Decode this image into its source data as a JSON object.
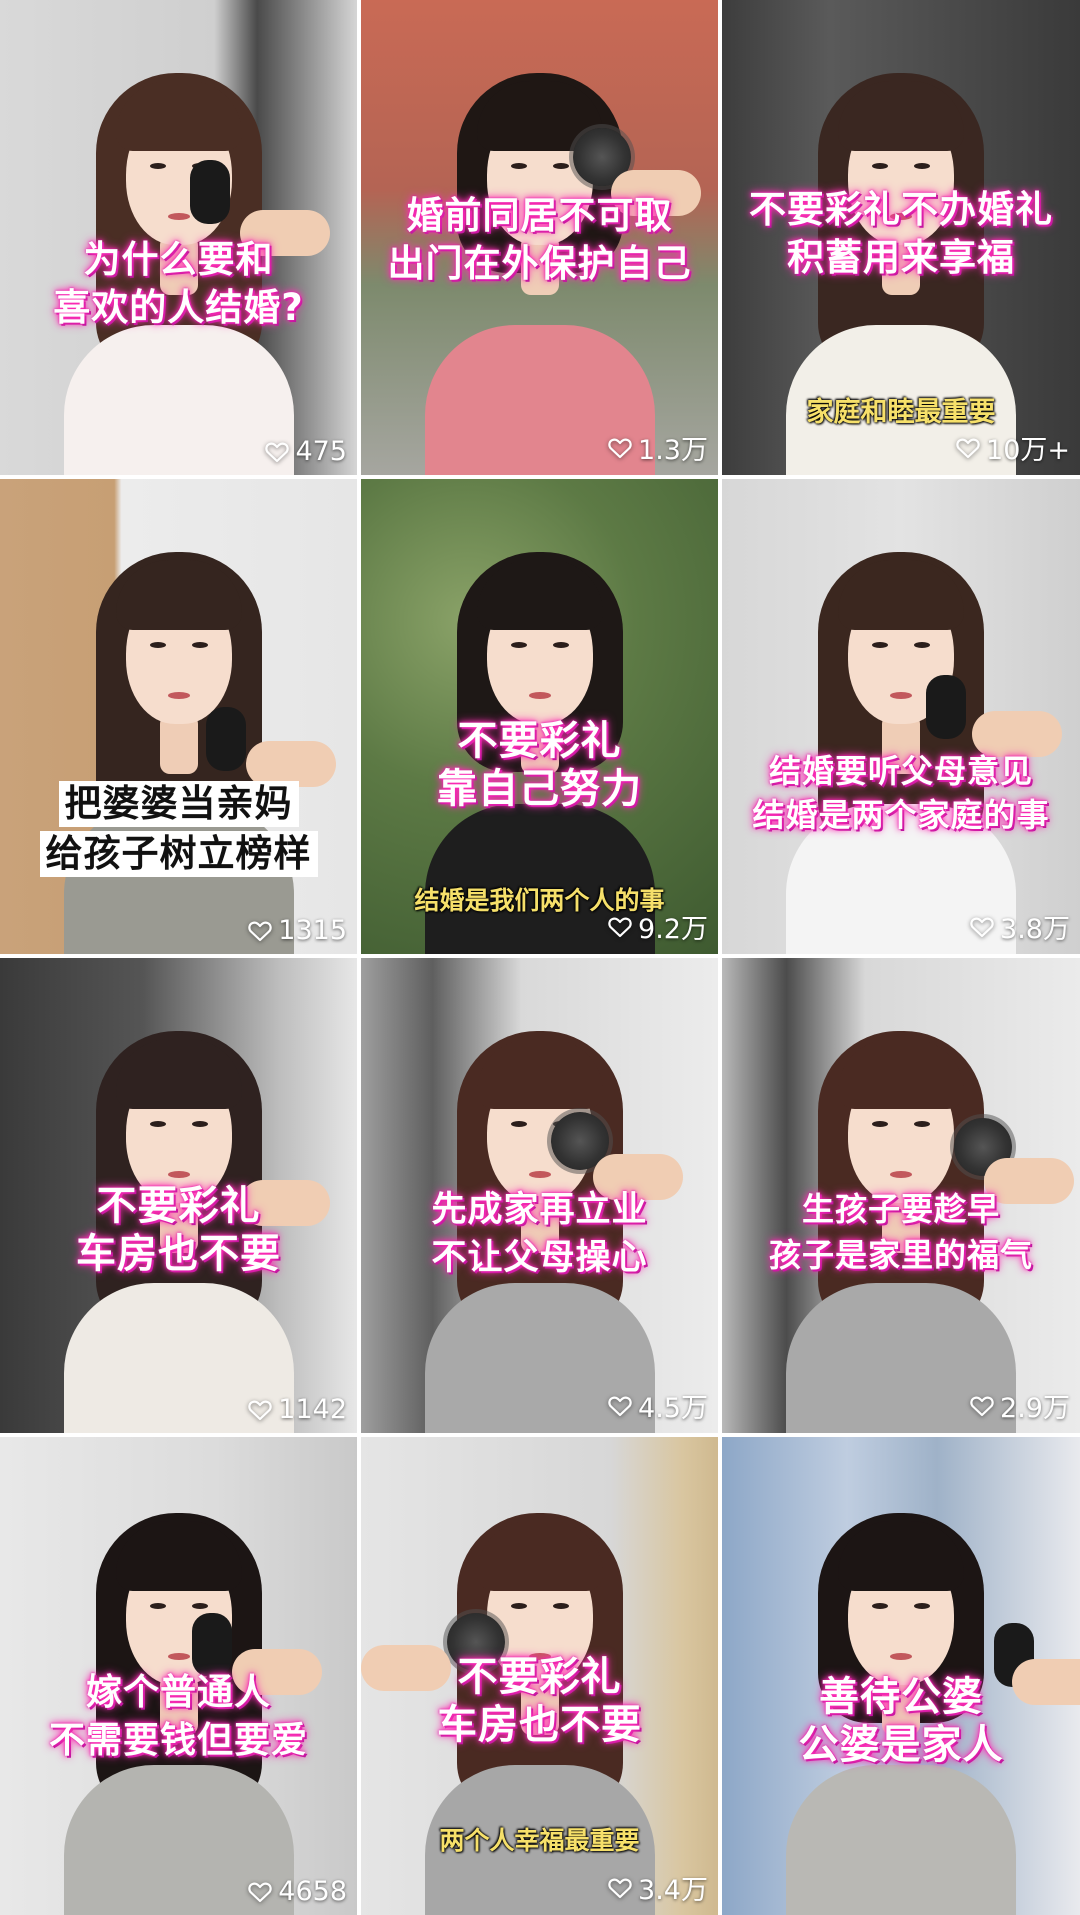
{
  "tiles": [
    {
      "caption": [
        "为什么要和",
        "喜欢的人结婚?"
      ],
      "subcaption": "",
      "likes": "475"
    },
    {
      "caption": [
        "婚前同居不可取",
        "出门在外保护自己"
      ],
      "subcaption": "",
      "likes": "1.3万"
    },
    {
      "caption": [
        "不要彩礼不办婚礼",
        "积蓄用来享福"
      ],
      "subcaption": "家庭和睦最重要",
      "likes": "10万+"
    },
    {
      "caption": [
        "把婆婆当亲妈",
        "给孩子树立榜样"
      ],
      "subcaption": "",
      "likes": "1315"
    },
    {
      "caption": [
        "不要彩礼",
        "靠自己努力"
      ],
      "subcaption": "结婚是我们两个人的事",
      "likes": "9.2万"
    },
    {
      "caption": [
        "结婚要听父母意见",
        "结婚是两个家庭的事"
      ],
      "subcaption": "",
      "likes": "3.8万"
    },
    {
      "caption": [
        "不要彩礼",
        "车房也不要"
      ],
      "subcaption": "",
      "likes": "1142"
    },
    {
      "caption": [
        "先成家再立业",
        "不让父母操心"
      ],
      "subcaption": "",
      "likes": "4.5万"
    },
    {
      "caption": [
        "生孩子要趁早",
        "孩子是家里的福气"
      ],
      "subcaption": "",
      "likes": "2.9万"
    },
    {
      "caption": [
        "嫁个普通人",
        "不需要钱但要爱"
      ],
      "subcaption": "",
      "likes": "4658"
    },
    {
      "caption": [
        "不要彩礼",
        "车房也不要"
      ],
      "subcaption": "两个人幸福最重要",
      "likes": "3.4万"
    },
    {
      "caption": [
        "善待公婆",
        "公婆是家人"
      ],
      "subcaption": "",
      "likes": ""
    }
  ],
  "icons": {
    "like": "heart-outline-icon"
  },
  "colors": {
    "caption_glow": "#ff2fb6",
    "subcaption": "#f6e06a",
    "likes_text": "#ffffff"
  }
}
